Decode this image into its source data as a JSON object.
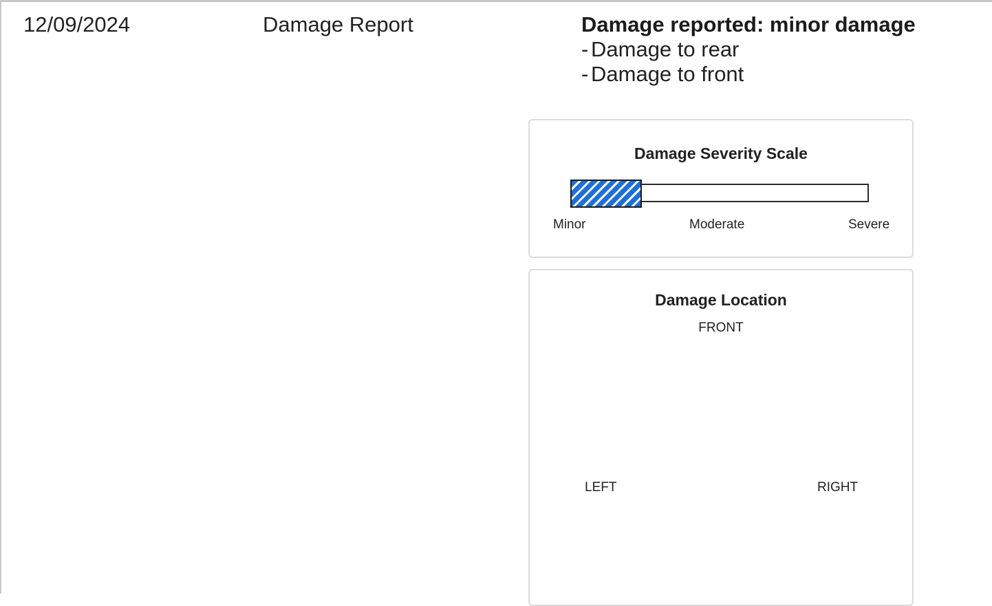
{
  "header": {
    "date": "12/09/2024",
    "title": "Damage Report"
  },
  "summary": {
    "heading": "Damage reported: minor damage",
    "items": [
      "Damage to rear",
      "Damage to front"
    ]
  },
  "severity_scale": {
    "title": "Damage Severity Scale",
    "labels": {
      "minor": "Minor",
      "moderate": "Moderate",
      "severe": "Severe"
    },
    "level_fraction": 0.24,
    "fill_color": "#1f6fd6"
  },
  "location": {
    "title": "Damage Location",
    "front": "FRONT",
    "left": "LEFT",
    "right": "RIGHT"
  }
}
